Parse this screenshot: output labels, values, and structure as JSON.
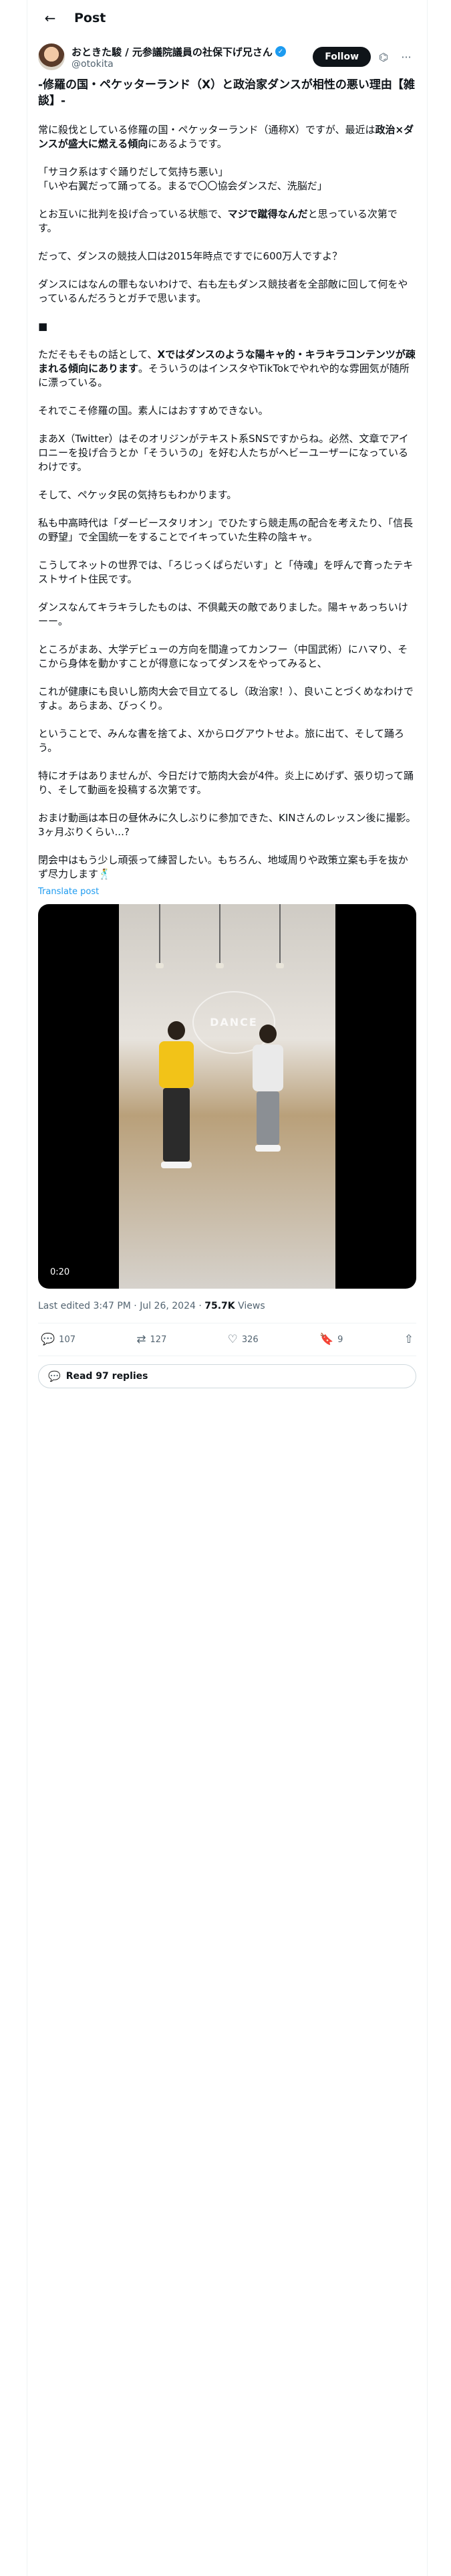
{
  "header": {
    "title": "Post",
    "back_icon": "←"
  },
  "author": {
    "display_name": "おときた駿 / 元参議院議員の社保下げ兄さん",
    "handle": "@otokita",
    "follow_label": "Follow",
    "verified_icon": "✓",
    "grok_icon": "⌬",
    "more_icon": "···"
  },
  "post": {
    "title": "-修羅の国・ペケッターランド（X）と政治家ダンスが相性の悪い理由【雑談】-",
    "p1": "常に殺伐としている修羅の国・ペケッターランド（通称X）ですが、最近は",
    "p1_bold": "政治×ダンスが盛大に燃える傾向",
    "p1_tail": "にあるようです。",
    "p2": "「サヨク系はすぐ踊りだして気持ち悪い」\n「いや右翼だって踊ってる。まるで〇〇協会ダンスだ、洗脳だ」",
    "p3a": "とお互いに批判を投げ合っている状態で、",
    "p3_bold": "マジで蹴得なんだ",
    "p3b": "と思っている次第です。",
    "p4": "だって、ダンスの競技人口は2015年時点ですでに600万人ですよ？",
    "p5": "ダンスにはなんの罪もないわけで、右も左もダンス競技者を全部敵に回して何をやっているんだろうとガチで思います。",
    "p6a": "ただそもそもの話として、",
    "p6_bold": "Xではダンスのような陽キャ的・キラキラコンテンツが疎まれる傾向にあります",
    "p6b": "。そういうのはインスタやTikTokでやれや的な雰囲気が随所に漂っている。",
    "p7": "それでこそ修羅の国。素人にはおすすめできない。",
    "p8": "まあX（Twitter）はそのオリジンがテキスト系SNSですからね。必然、文章でアイロニーを投げ合うとか「そういうの」を好む人たちがヘビーユーザーになっているわけです。",
    "p9": "そして、ペケッタ民の気持ちもわかります。",
    "p10": "私も中高時代は「ダービースタリオン」でひたすら競走馬の配合を考えたり、「信長の野望」で全国統一をすることでイキっていた生粋の陰キャ。",
    "p11": "こうしてネットの世界では、「ろじっくぱらだいす」と「侍魂」を呼んで育ったテキストサイト住民です。",
    "p12": "ダンスなんてキラキラしたものは、不倶戴天の敵でありました。陽キャあっちいけーー。",
    "p13": "ところがまあ、大学デビューの方向を間違ってカンフー（中国武術）にハマり、そこから身体を動かすことが得意になってダンスをやってみると、",
    "p14": "これが健康にも良いし筋肉大会で目立てるし（政治家！）、良いことづくめなわけですよ。あらまあ、びっくり。",
    "p15": "ということで、みんな書を捨てよ、Xからログアウトせよ。旅に出て、そして踊ろう。",
    "p16": "特にオチはありませんが、今日だけで筋肉大会が4件。炎上にめげず、張り切って踊り、そして動画を投稿する次第です。",
    "p17": "おまけ動画は本日の昼休みに久しぶりに参加できた、KINさんのレッスン後に撮影。3ヶ月ぶりくらい...?",
    "p18": "閉会中はもう少し頑張って練習したい。もちろん、地域周りや政策立案も手を抜かず尽力します🕺",
    "separator_icon": "■",
    "translate_label": "Translate post"
  },
  "video": {
    "timestamp": "0:20",
    "wall_text": "DANCE"
  },
  "meta": {
    "edited": "Last edited 3:47 PM · Jul 26, 2024 · ",
    "views_count": "75.7K",
    "views_label": " Views"
  },
  "actions": {
    "reply_icon": "💬",
    "reply_count": "107",
    "retweet_icon": "⇄",
    "retweet_count": "127",
    "like_icon": "♡",
    "like_count": "326",
    "bookmark_icon": "🔖",
    "bookmark_count": "9",
    "share_icon": "⇧"
  },
  "replies": {
    "icon": "💬",
    "label": "Read 97 replies"
  }
}
